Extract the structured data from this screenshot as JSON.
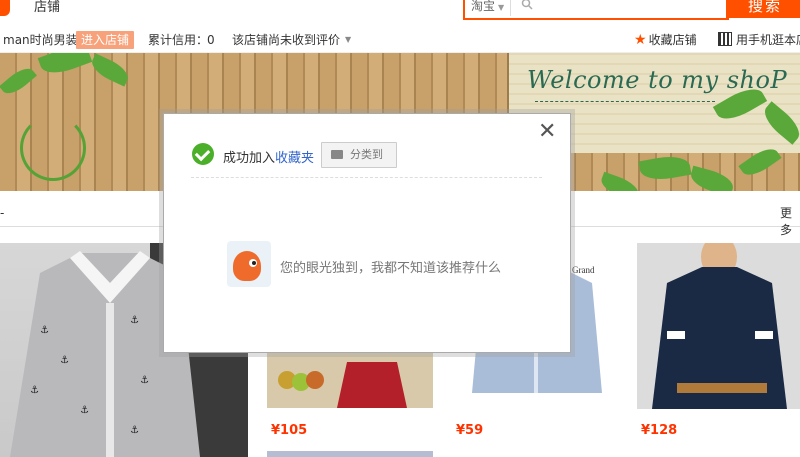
{
  "topbar": {
    "shop_label": "店铺",
    "search_scope": "淘宝",
    "search_button": "搜索"
  },
  "inforow": {
    "shop_name": "man时尚男装",
    "enter_shop": "进入店铺",
    "credit_label": "累计信用：",
    "credit_value": "0",
    "reviews_text": "该店铺尚未收到评价",
    "favorite_shop": "收藏店铺",
    "mobile_shop": "用手机逛本店"
  },
  "banner": {
    "welcome": "Welcome to my shoP"
  },
  "nav": {
    "more": "更多"
  },
  "products": [
    {
      "price": "¥105"
    },
    {
      "price": "¥59"
    },
    {
      "price": "¥128"
    }
  ],
  "modal": {
    "success_text": "成功加入",
    "favorites_link": "收藏夹",
    "category_button": "分类到",
    "empty_message": "您的眼光独到，我都不知道该推荐什么"
  },
  "colors": {
    "brand": "#ff5000",
    "success": "#4caf2a",
    "link": "#3366cc",
    "price": "#ff3300"
  }
}
